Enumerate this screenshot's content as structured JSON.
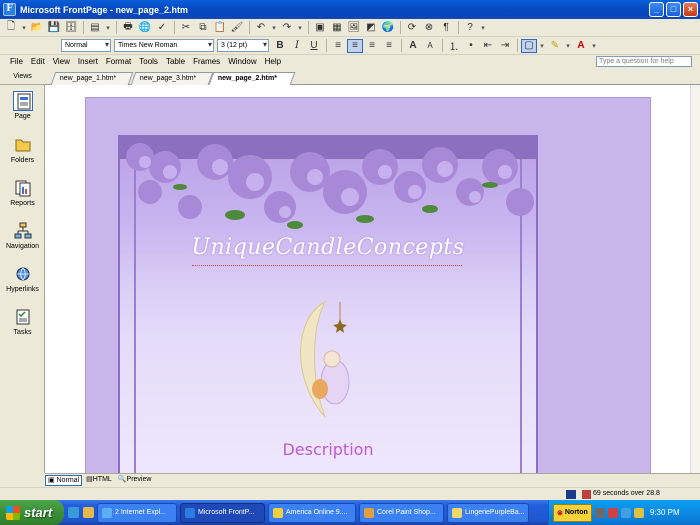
{
  "window": {
    "title": "Microsoft FrontPage - new_page_2.htm"
  },
  "toolbar_format": {
    "style": "Normal",
    "font": "Times New Roman",
    "size": "3 (12 pt)"
  },
  "menu": {
    "items": [
      "File",
      "Edit",
      "View",
      "Insert",
      "Format",
      "Tools",
      "Table",
      "Frames",
      "Window",
      "Help"
    ],
    "help_placeholder": "Type a question for help"
  },
  "views": {
    "header": "Views",
    "items": [
      {
        "label": "Page",
        "icon": "page-view-icon"
      },
      {
        "label": "Folders",
        "icon": "folders-icon"
      },
      {
        "label": "Reports",
        "icon": "reports-icon"
      },
      {
        "label": "Navigation",
        "icon": "navigation-icon"
      },
      {
        "label": "Hyperlinks",
        "icon": "hyperlinks-icon"
      },
      {
        "label": "Tasks",
        "icon": "tasks-icon"
      }
    ]
  },
  "tabs": [
    "new_page_1.htm*",
    "new_page_3.htm*",
    "new_page_2.htm*"
  ],
  "page": {
    "site_title": "UniqueCandleConcepts",
    "description": "Description",
    "colors": {
      "background": "#c9b7ec",
      "panel": "#dcd0f6",
      "description": "#c25ad0"
    }
  },
  "viewbar": {
    "normal": "Normal",
    "html": "HTML",
    "preview": "Preview"
  },
  "status": {
    "text": "69 seconds over 28.8"
  },
  "taskbar": {
    "start": "start",
    "buttons": [
      "2 Internet Expl...",
      "Microsoft FrontP...",
      "America Online 9....",
      "Corel Paint Shop...",
      "LingeriePurpleBa..."
    ],
    "norton": "Norton",
    "clock": "9:30 PM"
  }
}
